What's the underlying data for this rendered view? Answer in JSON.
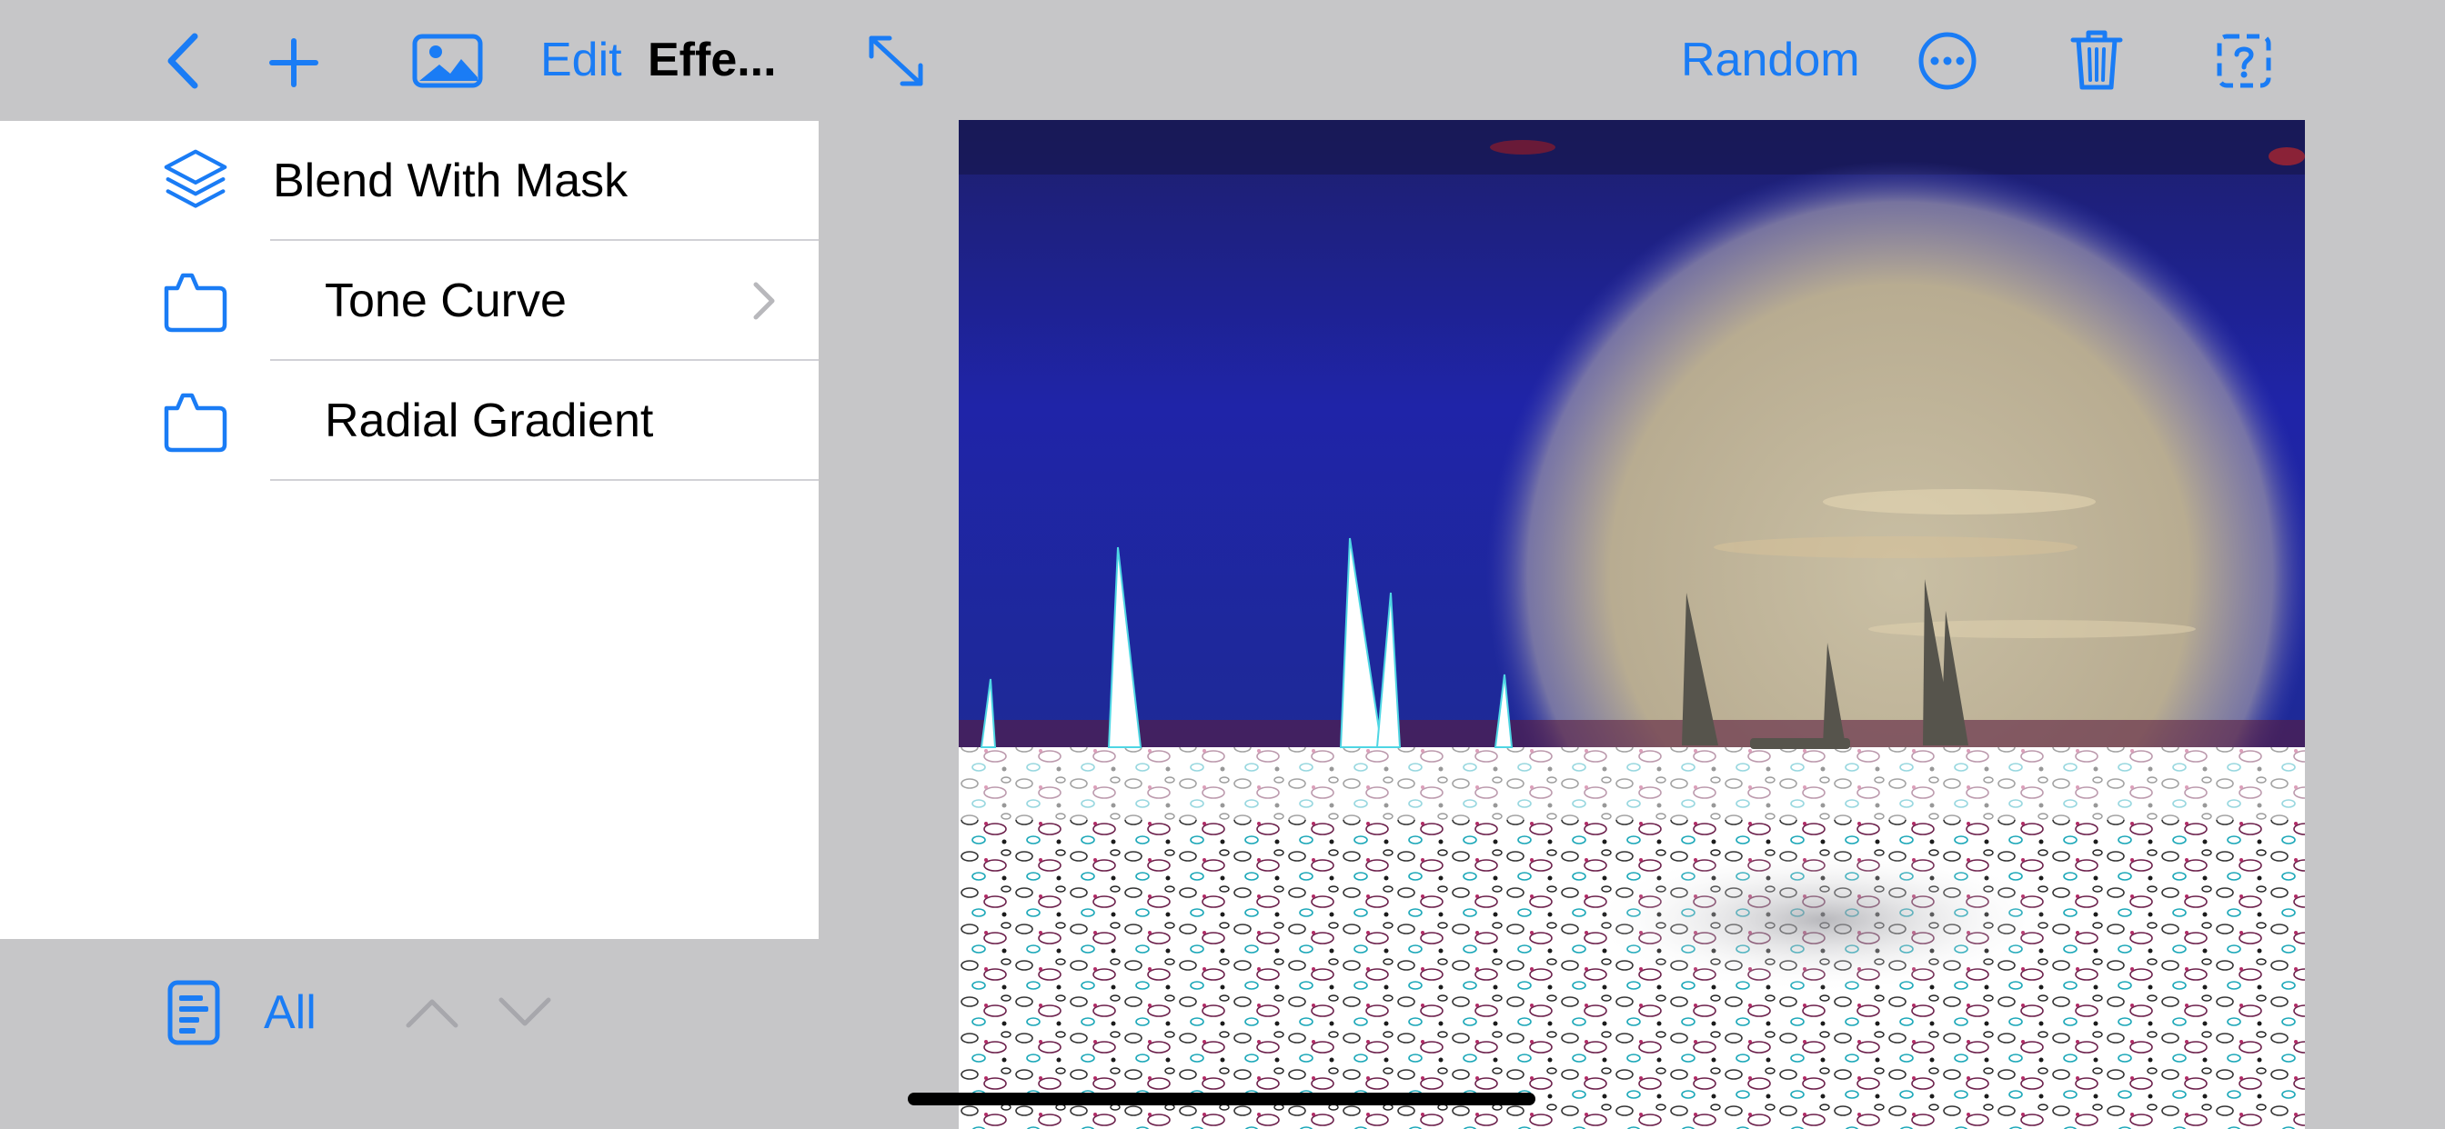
{
  "toolbar": {
    "edit_label": "Edit",
    "title": "Effe...",
    "random_label": "Random",
    "icons": {
      "back": "chevron-left-icon",
      "add": "plus-icon",
      "photo": "photo-icon",
      "expand": "expand-arrows-icon",
      "more": "ellipsis-circle-icon",
      "delete": "trash-icon",
      "help": "dashed-question-icon"
    }
  },
  "sidebar": {
    "items": [
      {
        "label": "Blend With Mask",
        "icon": "layers-icon",
        "indent": 0,
        "has_chevron": false
      },
      {
        "label": "Tone Curve",
        "icon": "tag-shape-icon",
        "indent": 1,
        "has_chevron": true
      },
      {
        "label": "Radial Gradient",
        "icon": "tag-shape-icon",
        "indent": 1,
        "has_chevron": false
      }
    ]
  },
  "bottombar": {
    "filter_label": "All",
    "icons": {
      "document": "document-list-icon",
      "up": "chevron-up-icon",
      "down": "chevron-down-icon"
    }
  },
  "colors": {
    "accent": "#1a7cf5",
    "toolbar_bg": "#c6c6c8",
    "panel_bg": "#ffffff"
  }
}
